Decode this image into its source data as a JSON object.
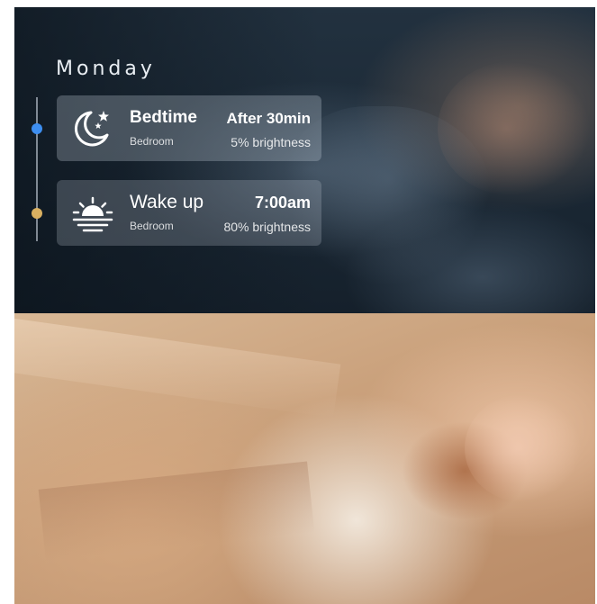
{
  "day": "Monday",
  "schedules": [
    {
      "title": "Bedtime",
      "room": "Bedroom",
      "value": "After 30min",
      "detail": "5% brightness",
      "icon": "moon-stars-icon",
      "dot_color": "#3d8ef0"
    },
    {
      "title": "Wake up",
      "room": "Bedroom",
      "value": "7:00am",
      "detail": "80% brightness",
      "icon": "sunrise-icon",
      "dot_color": "#d9b061"
    }
  ]
}
